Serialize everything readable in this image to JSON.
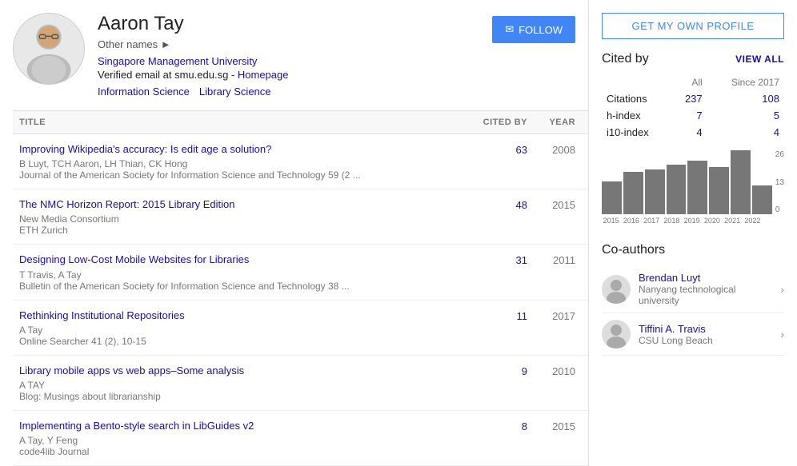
{
  "profile": {
    "name": "Aaron Tay",
    "other_names_label": "Other names",
    "affiliation": "Singapore Management University",
    "verified_email": "Verified email at smu.edu.sg",
    "homepage_label": "Homepage",
    "tags": [
      "Information Science",
      "Library Science"
    ],
    "follow_label": "FOLLOW",
    "avatar_icon": "👤"
  },
  "papers_header": {
    "title_col": "TITLE",
    "cited_col": "CITED BY",
    "year_col": "YEAR"
  },
  "papers": [
    {
      "title": "Improving Wikipedia's accuracy: Is edit age a solution?",
      "authors": "B Luyt, TCH Aaron, LH Thian, CK Hong",
      "journal": "Journal of the American Society for Information Science and Technology 59 (2 ...",
      "cited": "63",
      "year": "2008"
    },
    {
      "title": "The NMC Horizon Report: 2015 Library Edition",
      "authors": "New Media Consortium",
      "journal": "ETH Zurich",
      "cited": "48",
      "year": "2015"
    },
    {
      "title": "Designing Low-Cost Mobile Websites for Libraries",
      "authors": "T Travis, A Tay",
      "journal": "Bulletin of the American Society for Information Science and Technology 38 ...",
      "cited": "31",
      "year": "2011"
    },
    {
      "title": "Rethinking Institutional Repositories",
      "authors": "A Tay",
      "journal": "Online Searcher 41 (2), 10-15",
      "cited": "11",
      "year": "2017"
    },
    {
      "title": "Library mobile apps vs web apps–Some analysis",
      "authors": "A TAY",
      "journal": "Blog: Musings about librarianship",
      "cited": "9",
      "year": "2010"
    },
    {
      "title": "Implementing a Bento-style search in LibGuides v2",
      "authors": "A Tay, Y Feng",
      "journal": "code4lib Journal",
      "cited": "8",
      "year": "2015"
    }
  ],
  "right_panel": {
    "get_profile_btn": "GET MY OWN PROFILE",
    "cited_by_title": "Cited by",
    "view_all_label": "VIEW ALL",
    "stats": {
      "headers": [
        "",
        "All",
        "Since 2017"
      ],
      "rows": [
        {
          "label": "Citations",
          "all": "237",
          "since": "108"
        },
        {
          "label": "h-index",
          "all": "7",
          "since": "5"
        },
        {
          "label": "i10-index",
          "all": "4",
          "since": "4"
        }
      ]
    },
    "chart": {
      "y_labels": [
        "26",
        "13",
        "0"
      ],
      "bars": [
        {
          "year": "2015",
          "height": 40
        },
        {
          "year": "2016",
          "height": 52
        },
        {
          "year": "2017",
          "height": 55
        },
        {
          "year": "2018",
          "height": 60
        },
        {
          "year": "2019",
          "height": 65
        },
        {
          "year": "2020",
          "height": 58
        },
        {
          "year": "2021",
          "height": 78
        },
        {
          "year": "2022",
          "height": 35
        }
      ]
    },
    "coauthors_title": "Co-authors",
    "coauthors": [
      {
        "name": "Brendan Luyt",
        "affiliation": "Nanyang technological university",
        "avatar_icon": "👤"
      },
      {
        "name": "Tiffini A. Travis",
        "affiliation": "CSU Long Beach",
        "avatar_icon": "👤"
      }
    ]
  }
}
